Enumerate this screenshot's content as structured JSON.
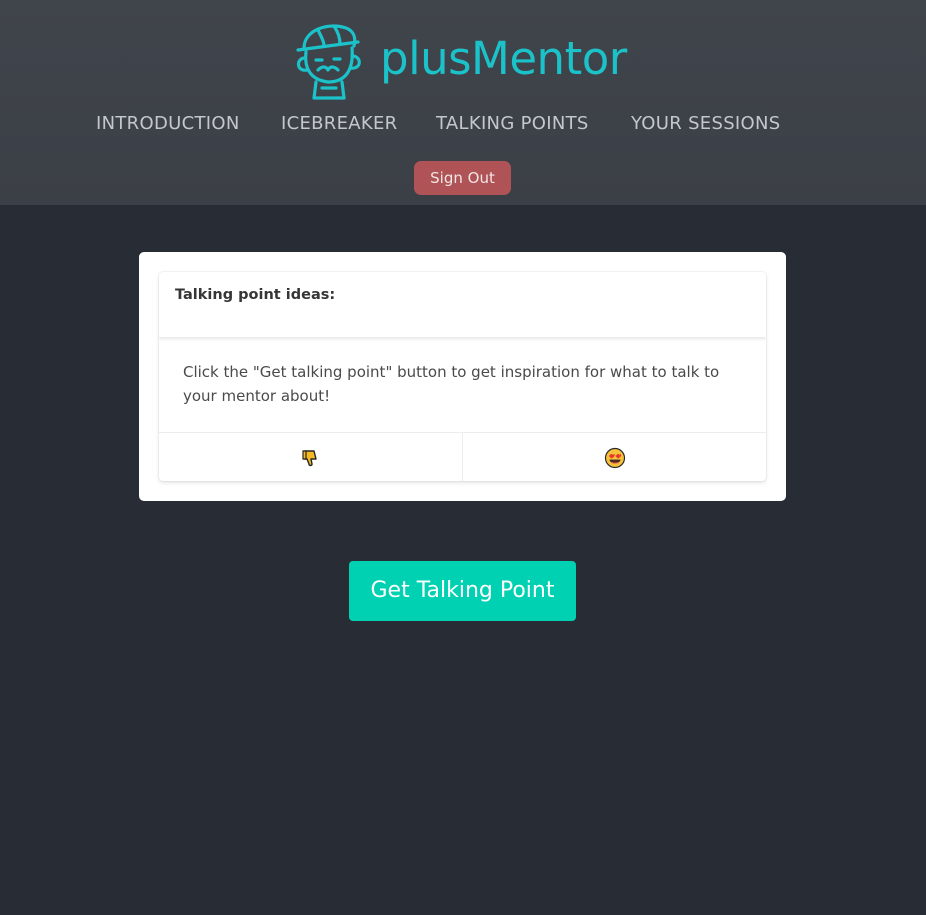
{
  "brand": {
    "name": "plusMentor",
    "logo_icon": "mentor-avatar-logo",
    "color": "#1cc2c9"
  },
  "nav": {
    "items": [
      {
        "label": "INTRODUCTION"
      },
      {
        "label": "ICEBREAKER"
      },
      {
        "label": "TALKING POINTS"
      },
      {
        "label": "YOUR SESSIONS"
      }
    ]
  },
  "header": {
    "signout_label": "Sign Out",
    "signout_color": "#b05356"
  },
  "card": {
    "title": "Talking point ideas:",
    "content": "Click the \"Get talking point\" button to get inspiration for what to talk to your mentor about!",
    "footer": {
      "dislike_icon": "thumbs-down-icon",
      "love_icon": "heart-eyes-icon"
    }
  },
  "actions": {
    "get_talking_point_label": "Get Talking Point",
    "button_color": "#00d1b2"
  },
  "colors": {
    "background": "#282c34",
    "header_background": "#3e4249"
  }
}
